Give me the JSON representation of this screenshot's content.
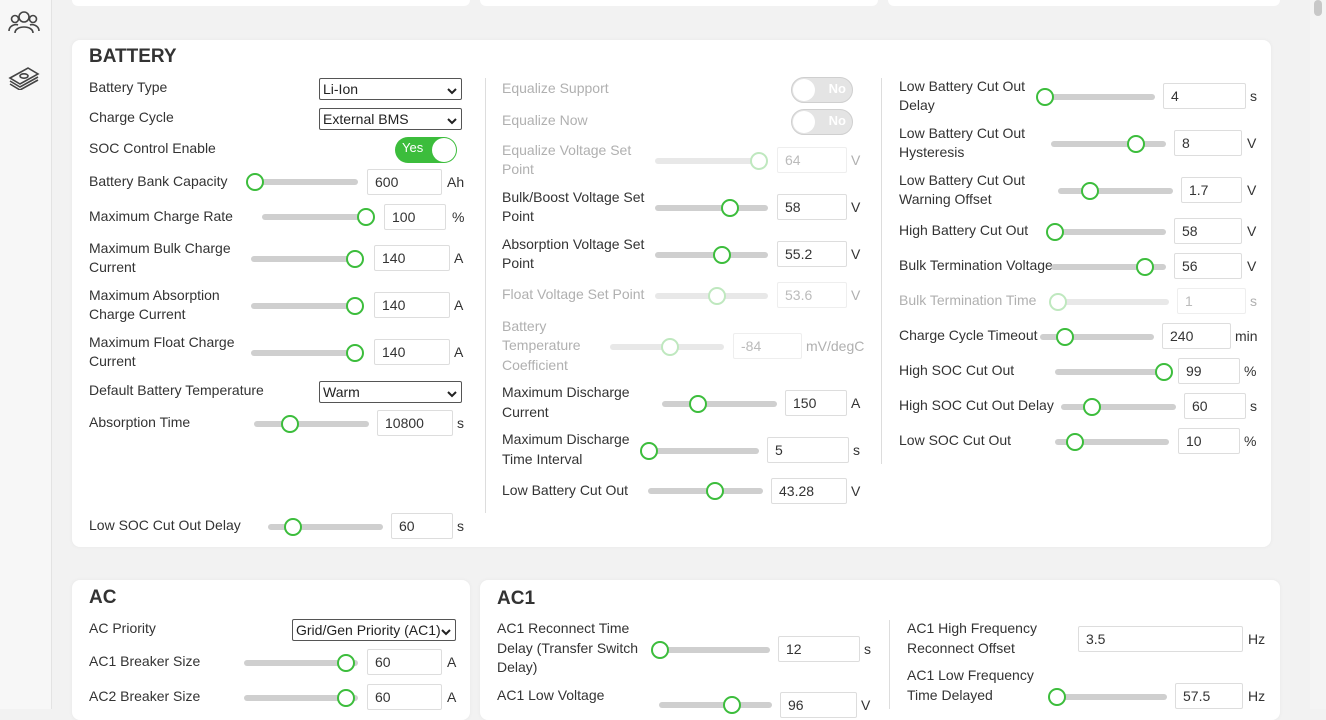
{
  "sidebar": {
    "icons": [
      "users-icon",
      "money-icon"
    ]
  },
  "colors": {
    "accent": "#3cbd3c",
    "track": "#cfcfcf"
  },
  "battery": {
    "title": "BATTERY",
    "col1": {
      "battery_type": {
        "label": "Battery Type",
        "value": "Li-Ion"
      },
      "charge_cycle": {
        "label": "Charge Cycle",
        "value": "External BMS"
      },
      "soc_control": {
        "label": "SOC Control Enable",
        "value": "Yes"
      },
      "bank_capacity": {
        "label": "Battery Bank Capacity",
        "value": "600",
        "unit": "Ah",
        "level": 0.05
      },
      "max_charge_rate": {
        "label": "Maximum Charge Rate",
        "value": "100",
        "unit": "%",
        "level": 1.0
      },
      "max_bulk_current": {
        "label1": "Maximum Bulk Charge",
        "label2": "Current",
        "value": "140",
        "unit": "A",
        "level": 1.0
      },
      "max_absorption_current": {
        "label1": "Maximum Absorption",
        "label2": "Charge Current",
        "value": "140",
        "unit": "A",
        "level": 1.0
      },
      "max_float_current": {
        "label1": "Maximum Float Charge",
        "label2": "Current",
        "value": "140",
        "unit": "A",
        "level": 1.0
      },
      "default_temp": {
        "label": "Default Battery Temperature",
        "value": "Warm"
      },
      "absorption_time": {
        "label": "Absorption Time",
        "value": "10800",
        "unit": "s",
        "level": 0.3
      },
      "low_soc_delay": {
        "label": "Low SOC Cut Out Delay",
        "value": "60",
        "unit": "s",
        "level": 0.2
      }
    },
    "col2": {
      "equalize_support": {
        "label": "Equalize Support",
        "value": "No"
      },
      "equalize_now": {
        "label": "Equalize Now",
        "value": "No"
      },
      "equalize_voltage": {
        "label1": "Equalize Voltage Set",
        "label2": "Point",
        "value": "64",
        "unit": "V",
        "level": 0.95
      },
      "bulk_voltage": {
        "label1": "Bulk/Boost Voltage Set",
        "label2": "Point",
        "value": "58",
        "unit": "V",
        "level": 0.68
      },
      "absorption_voltage": {
        "label1": "Absorption Voltage Set",
        "label2": "Point",
        "value": "55.2",
        "unit": "V",
        "level": 0.6
      },
      "float_voltage": {
        "label": "Float Voltage Set Point",
        "value": "53.6",
        "unit": "V",
        "level": 0.55
      },
      "temp_coeff": {
        "label1": "Battery",
        "label2": "Temperature",
        "label3": "Coefficient",
        "value": "-84",
        "unit": "mV/degC",
        "level": 0.53
      },
      "max_discharge_current": {
        "label1": "Maximum Discharge",
        "label2": "Current",
        "value": "150",
        "unit": "A",
        "level": 0.3
      },
      "max_discharge_time": {
        "label1": "Maximum Discharge",
        "label2": "Time Interval",
        "value": "5",
        "unit": "s",
        "level": 0.0
      },
      "low_batt_cutout": {
        "label": "Low Battery Cut Out",
        "value": "43.28",
        "unit": "V",
        "level": 0.59
      }
    },
    "col3": {
      "low_batt_cutout_delay": {
        "label1": "Low Battery Cut Out",
        "label2": "Delay",
        "value": "4",
        "unit": "s",
        "level": 0.0
      },
      "low_batt_hysteresis": {
        "label1": "Low Battery Cut Out",
        "label2": "Hysteresis",
        "value": "8",
        "unit": "V",
        "level": 0.76
      },
      "low_batt_warning": {
        "label1": "Low Battery Cut Out",
        "label2": "Warning Offset",
        "value": "1.7",
        "unit": "V",
        "level": 0.26
      },
      "high_batt_cutout": {
        "label": "High Battery Cut Out",
        "value": "58",
        "unit": "V",
        "level": 0.0
      },
      "bulk_term_voltage": {
        "label": "Bulk Termination Voltage",
        "value": "56",
        "unit": "V",
        "level": 0.84
      },
      "bulk_term_time": {
        "label": "Bulk Termination Time",
        "value": "1",
        "unit": "s",
        "level": 0.0
      },
      "charge_timeout": {
        "label": "Charge Cycle Timeout",
        "value": "240",
        "unit": "min",
        "level": 0.2
      },
      "high_soc": {
        "label": "High SOC Cut Out",
        "value": "99",
        "unit": "%",
        "level": 0.99
      },
      "high_soc_delay": {
        "label": "High SOC Cut Out Delay",
        "value": "60",
        "unit": "s",
        "level": 0.25
      },
      "low_soc": {
        "label": "Low SOC Cut Out",
        "value": "10",
        "unit": "%",
        "level": 0.15
      }
    }
  },
  "ac": {
    "title": "AC",
    "priority": {
      "label": "AC Priority",
      "value": "Grid/Gen Priority (AC1)"
    },
    "ac1_breaker": {
      "label": "AC1 Breaker Size",
      "value": "60",
      "unit": "A",
      "level": 0.92
    },
    "ac2_breaker": {
      "label": "AC2 Breaker Size",
      "value": "60",
      "unit": "A",
      "level": 0.92
    }
  },
  "ac1": {
    "title": "AC1",
    "reconnect_time": {
      "label1": "AC1 Reconnect Time",
      "label2": "Delay (Transfer Switch",
      "label3": "Delay)",
      "value": "12",
      "unit": "s",
      "level": 0.0
    },
    "low_voltage": {
      "label": "AC1 Low Voltage",
      "value": "96",
      "unit": "V",
      "level": 0.66
    },
    "high_freq_offset": {
      "label1": "AC1 High Frequency",
      "label2": "Reconnect Offset",
      "value": "3.5",
      "unit": "Hz"
    },
    "low_freq_delay": {
      "label1": "AC1 Low Frequency",
      "label2": "Time Delayed",
      "value": "57.5",
      "unit": "Hz",
      "level": 0.0
    }
  }
}
